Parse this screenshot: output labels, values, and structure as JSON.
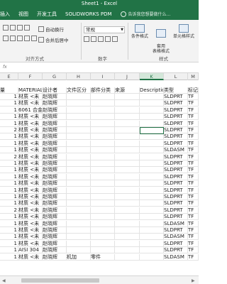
{
  "window": {
    "title": "Sheet1 - Excel"
  },
  "menu": {
    "tabs": [
      "插入",
      "视图",
      "开发工具",
      "SOLIDWORKS PDM"
    ],
    "tell_me": "告诉我您想要做什么..."
  },
  "ribbon": {
    "wrap_text": "自动换行",
    "merge_center": "合并后居中",
    "number_format": "常规",
    "group_alignment": "对齐方式",
    "group_number": "数字",
    "group_styles": "样式",
    "cond_format": "条件格式",
    "table_format": "套用\n表格格式",
    "cell_styles": "单元格样式"
  },
  "columns": [
    {
      "id": "E",
      "label": "E"
    },
    {
      "id": "F",
      "label": "F"
    },
    {
      "id": "G",
      "label": "G"
    },
    {
      "id": "H",
      "label": "H"
    },
    {
      "id": "I",
      "label": "I"
    },
    {
      "id": "J",
      "label": "J"
    },
    {
      "id": "K",
      "label": "K"
    },
    {
      "id": "L",
      "label": "L"
    },
    {
      "id": "M",
      "label": "M"
    }
  ],
  "header_row": [
    "量",
    "MATERIAL",
    "设计者",
    "文件区分",
    "部件分类",
    "来源",
    "Descriptio",
    "类型",
    "标记"
  ],
  "rows": [
    {
      "qty": "1",
      "mat": "材质 <未",
      "des": "赵晓辉",
      "type": "SLDPRT",
      "mark": "TF"
    },
    {
      "qty": "1",
      "mat": "材质 <未",
      "des": "赵晓辉",
      "type": "SLDPRT",
      "mark": "TF"
    },
    {
      "qty": "1",
      "mat": "6061 合金",
      "des": "赵晓辉",
      "type": "SLDPRT",
      "mark": "TF"
    },
    {
      "qty": "1",
      "mat": "材质 <未",
      "des": "赵晓辉",
      "type": "SLDPRT",
      "mark": "TF"
    },
    {
      "qty": "1",
      "mat": "材质 <未",
      "des": "赵晓辉",
      "type": "SLDPRT",
      "mark": "TF"
    },
    {
      "qty": "2",
      "mat": "材质 <未",
      "des": "赵晓辉",
      "type": "SLDPRT",
      "mark": "TF"
    },
    {
      "qty": "1",
      "mat": "材质 <未",
      "des": "赵晓辉",
      "type": "SLDPRT",
      "mark": "TF"
    },
    {
      "qty": "1",
      "mat": "材质 <未",
      "des": "赵晓辉",
      "type": "SLDPRT",
      "mark": "TF"
    },
    {
      "qty": "1",
      "mat": "材质 <未",
      "des": "赵晓辉",
      "type": "SLDASM",
      "mark": "TF"
    },
    {
      "qty": "2",
      "mat": "材质 <未",
      "des": "赵晓辉",
      "type": "SLDPRT",
      "mark": "TF"
    },
    {
      "qty": "1",
      "mat": "材质 <未",
      "des": "赵晓辉",
      "type": "SLDPRT",
      "mark": "TF"
    },
    {
      "qty": "1",
      "mat": "材质 <未",
      "des": "赵晓辉",
      "type": "SLDPRT",
      "mark": "TF"
    },
    {
      "qty": "1",
      "mat": "材质 <未",
      "des": "赵晓辉",
      "type": "SLDPRT",
      "mark": "TF"
    },
    {
      "qty": "1",
      "mat": "材质 <未",
      "des": "赵晓辉",
      "type": "SLDPRT",
      "mark": "TF"
    },
    {
      "qty": "1",
      "mat": "材质 <未",
      "des": "赵晓辉",
      "type": "SLDPRT",
      "mark": "TF"
    },
    {
      "qty": "1",
      "mat": "材质 <未",
      "des": "赵晓辉",
      "type": "SLDPRT",
      "mark": "TF"
    },
    {
      "qty": "1",
      "mat": "材质 <未",
      "des": "赵晓辉",
      "type": "SLDPRT",
      "mark": "TF"
    },
    {
      "qty": "2",
      "mat": "材质 <未",
      "des": "赵晓辉",
      "type": "SLDPRT",
      "mark": "TF"
    },
    {
      "qty": "1",
      "mat": "材质 <未",
      "des": "赵晓辉",
      "type": "SLDPRT",
      "mark": "TF"
    },
    {
      "qty": "1",
      "mat": "材质 <未",
      "des": "赵晓辉",
      "type": "SLDASM",
      "mark": "TF"
    },
    {
      "qty": "1",
      "mat": "材质 <未",
      "des": "赵晓辉",
      "type": "SLDPRT",
      "mark": "TF"
    },
    {
      "qty": "1",
      "mat": "材质 <未",
      "des": "赵晓辉",
      "type": "SLDASM",
      "mark": "TF"
    },
    {
      "qty": "1",
      "mat": "材质 <未",
      "des": "赵晓辉",
      "type": "SLDPRT",
      "mark": "TF"
    },
    {
      "qty": "1",
      "mat": "AISI 304",
      "des": "赵晓辉",
      "type": "SLDPRT",
      "mark": "TF"
    },
    {
      "qty": "1",
      "mat": "材质 <未",
      "des": "赵晓辉",
      "file": "机加",
      "part": "零件",
      "type": "SLDASM",
      "mark": "TF"
    }
  ]
}
